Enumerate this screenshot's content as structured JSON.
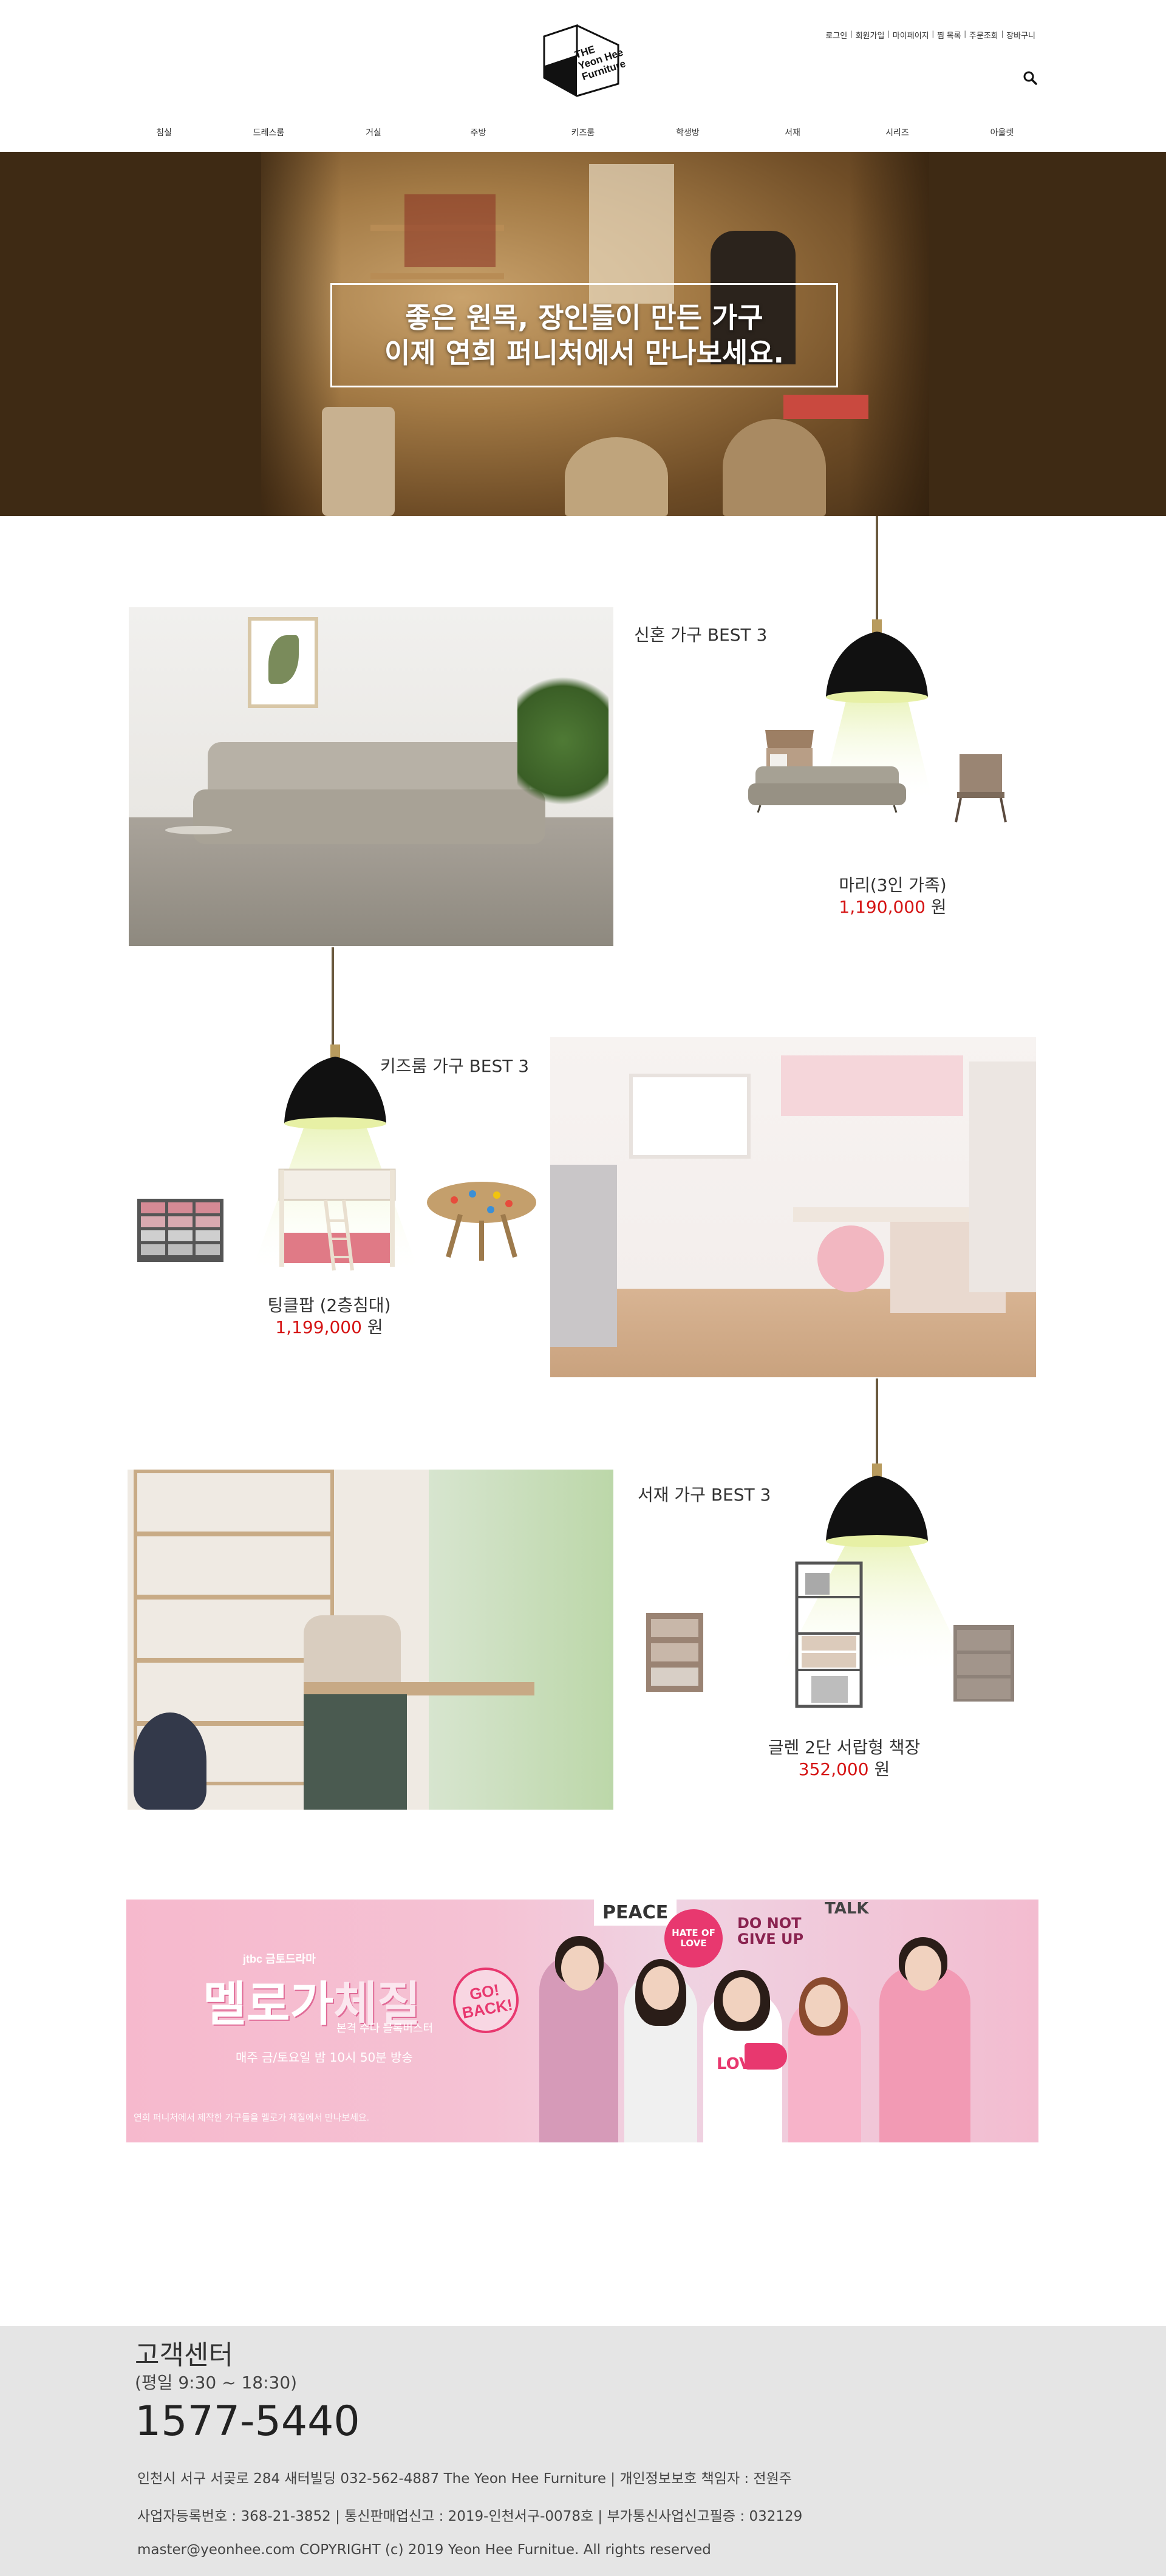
{
  "header": {
    "logo": {
      "line1": "THE",
      "line2": "Yeon Hee",
      "line3": "Furniture",
      "icon": "cube-logo-icon"
    },
    "util_links": [
      "로그인",
      "회원가입",
      "마이페이지",
      "찜 목록",
      "주문조회",
      "장바구니"
    ],
    "search_icon": "search-icon",
    "nav": [
      "침실",
      "드레스룸",
      "거실",
      "주방",
      "키즈룸",
      "학생방",
      "서재",
      "시리즈",
      "아울렛"
    ]
  },
  "hero": {
    "line1": "좋은 원목, 장인들이 만든 가구",
    "line2": "이제 연희 퍼니처에서 만나보세요."
  },
  "sections": [
    {
      "title": "신혼 가구 BEST 3",
      "name": "마리(3인 가족)",
      "price": "1,190,000",
      "unit": "원"
    },
    {
      "title": "키즈룸 가구 BEST 3",
      "name": "팅클팝 (2층침대)",
      "price": "1,199,000",
      "unit": "원"
    },
    {
      "title": "서재 가구 BEST 3",
      "name": "글렌 2단 서랍형 책장",
      "price": "352,000",
      "unit": "원"
    }
  ],
  "banner": {
    "brand": "jtbc 금토드라마",
    "title_a": "멜로가",
    "title_b": "체질",
    "subtitle": "본격 수다 블록버스터",
    "time": "매주 금/토요일 밤 10시 50분 방송",
    "go_back": "GO! BACK!",
    "signs": [
      "PEACE",
      "HATE OF LOVE",
      "DO NOT GIVE UP",
      "TALK",
      "LOVE"
    ],
    "copy": "연희 퍼니처에서 제작한 가구들을 멜로가 체질에서 만나보세요."
  },
  "footer": {
    "title": "고객센터",
    "hours": "(평일 9:30 ~ 18:30)",
    "phone": "1577-5440",
    "line1": "인천시 서구 서곶로 284 새터빌딩 032-562-4887 The Yeon Hee Furniture  |  개인정보보호 책임자 : 전원주",
    "line2": "사업자등록번호 : 368-21-3852  |  통신판매업신고 : 2019-인천서구-0078호  |  부가통신사업신고필증 : 032129",
    "line3": "master@yeonhee.com COPYRIGHT (c) 2019 Yeon Hee Furnitue. All rights reserved"
  },
  "colors": {
    "price": "#d51313",
    "hero_bg": "#3e2a14",
    "footer_bg": "#e5e5e5",
    "banner_pink": "#f5c2d4"
  }
}
